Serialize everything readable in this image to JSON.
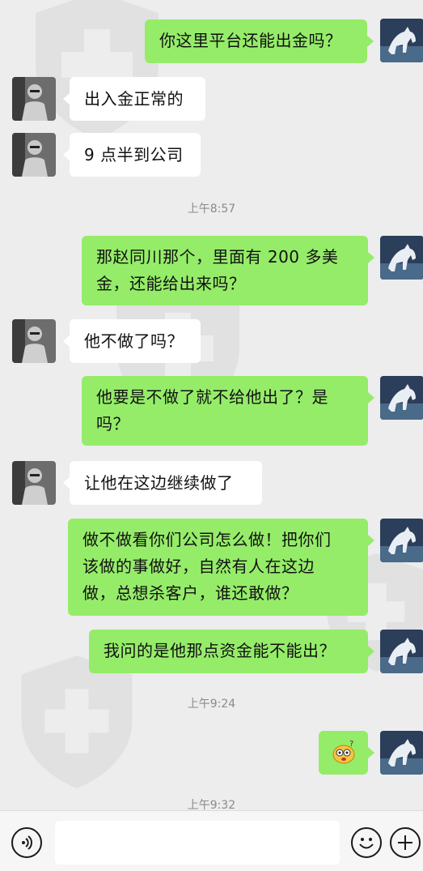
{
  "messages": [
    {
      "side": "out",
      "text": "你这里平台还能出金吗？"
    },
    {
      "side": "in",
      "text": "出入金正常的"
    },
    {
      "side": "in",
      "text": "9 点半到公司"
    },
    {
      "side": "out",
      "line1": "那赵同川那个，里面有 200 多美",
      "line2": "金，还能给出来吗？"
    },
    {
      "side": "in",
      "text": "他不做了吗？"
    },
    {
      "side": "out",
      "line1": "他要是不做了就不给他出了？是",
      "line2": "吗？"
    },
    {
      "side": "in",
      "text": "让他在这边继续做了"
    },
    {
      "side": "out",
      "line1": "做不做看你们公司怎么做！把你们",
      "line2": "该做的事做好，自然有人在这边",
      "line3": "做，总想杀客户，谁还敢做？"
    },
    {
      "side": "out",
      "text": "我问的是他那点资金能不能出？"
    },
    {
      "side": "out",
      "sticker": "emoji-sticker"
    }
  ],
  "timestamps": [
    "上午8:57",
    "上午9:24",
    "上午9:32"
  ],
  "icons": {
    "voice": "voice-icon",
    "emoji": "emoji-icon",
    "plus": "plus-icon",
    "watermark": "shield-cross-watermark"
  },
  "colors": {
    "background": "#ededed",
    "incoming_bubble": "#ffffff",
    "outgoing_bubble": "#95ec69",
    "timestamp": "#8a8a8a"
  }
}
